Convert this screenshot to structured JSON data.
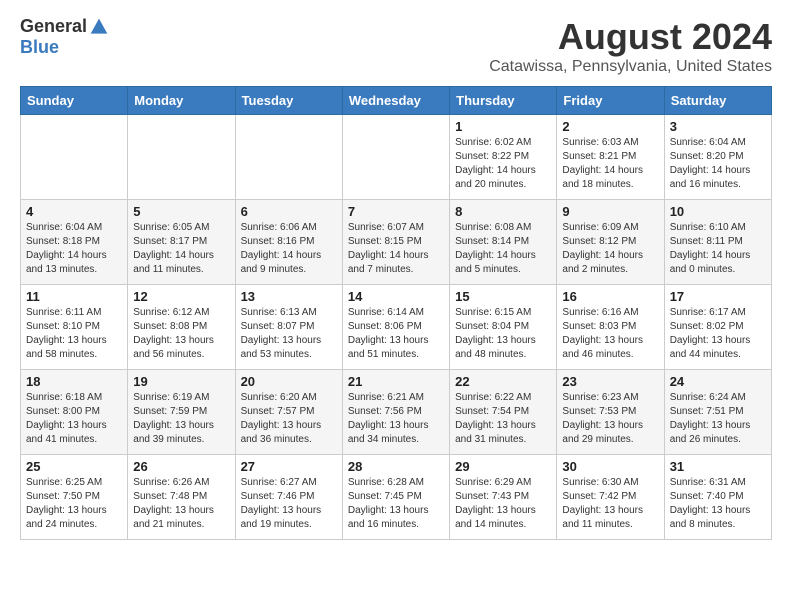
{
  "logo": {
    "general": "General",
    "blue": "Blue"
  },
  "title": {
    "month_year": "August 2024",
    "location": "Catawissa, Pennsylvania, United States"
  },
  "headers": [
    "Sunday",
    "Monday",
    "Tuesday",
    "Wednesday",
    "Thursday",
    "Friday",
    "Saturday"
  ],
  "weeks": [
    [
      {
        "day": "",
        "sunrise": "",
        "sunset": "",
        "daylight": ""
      },
      {
        "day": "",
        "sunrise": "",
        "sunset": "",
        "daylight": ""
      },
      {
        "day": "",
        "sunrise": "",
        "sunset": "",
        "daylight": ""
      },
      {
        "day": "",
        "sunrise": "",
        "sunset": "",
        "daylight": ""
      },
      {
        "day": "1",
        "sunrise": "Sunrise: 6:02 AM",
        "sunset": "Sunset: 8:22 PM",
        "daylight": "Daylight: 14 hours and 20 minutes."
      },
      {
        "day": "2",
        "sunrise": "Sunrise: 6:03 AM",
        "sunset": "Sunset: 8:21 PM",
        "daylight": "Daylight: 14 hours and 18 minutes."
      },
      {
        "day": "3",
        "sunrise": "Sunrise: 6:04 AM",
        "sunset": "Sunset: 8:20 PM",
        "daylight": "Daylight: 14 hours and 16 minutes."
      }
    ],
    [
      {
        "day": "4",
        "sunrise": "Sunrise: 6:04 AM",
        "sunset": "Sunset: 8:18 PM",
        "daylight": "Daylight: 14 hours and 13 minutes."
      },
      {
        "day": "5",
        "sunrise": "Sunrise: 6:05 AM",
        "sunset": "Sunset: 8:17 PM",
        "daylight": "Daylight: 14 hours and 11 minutes."
      },
      {
        "day": "6",
        "sunrise": "Sunrise: 6:06 AM",
        "sunset": "Sunset: 8:16 PM",
        "daylight": "Daylight: 14 hours and 9 minutes."
      },
      {
        "day": "7",
        "sunrise": "Sunrise: 6:07 AM",
        "sunset": "Sunset: 8:15 PM",
        "daylight": "Daylight: 14 hours and 7 minutes."
      },
      {
        "day": "8",
        "sunrise": "Sunrise: 6:08 AM",
        "sunset": "Sunset: 8:14 PM",
        "daylight": "Daylight: 14 hours and 5 minutes."
      },
      {
        "day": "9",
        "sunrise": "Sunrise: 6:09 AM",
        "sunset": "Sunset: 8:12 PM",
        "daylight": "Daylight: 14 hours and 2 minutes."
      },
      {
        "day": "10",
        "sunrise": "Sunrise: 6:10 AM",
        "sunset": "Sunset: 8:11 PM",
        "daylight": "Daylight: 14 hours and 0 minutes."
      }
    ],
    [
      {
        "day": "11",
        "sunrise": "Sunrise: 6:11 AM",
        "sunset": "Sunset: 8:10 PM",
        "daylight": "Daylight: 13 hours and 58 minutes."
      },
      {
        "day": "12",
        "sunrise": "Sunrise: 6:12 AM",
        "sunset": "Sunset: 8:08 PM",
        "daylight": "Daylight: 13 hours and 56 minutes."
      },
      {
        "day": "13",
        "sunrise": "Sunrise: 6:13 AM",
        "sunset": "Sunset: 8:07 PM",
        "daylight": "Daylight: 13 hours and 53 minutes."
      },
      {
        "day": "14",
        "sunrise": "Sunrise: 6:14 AM",
        "sunset": "Sunset: 8:06 PM",
        "daylight": "Daylight: 13 hours and 51 minutes."
      },
      {
        "day": "15",
        "sunrise": "Sunrise: 6:15 AM",
        "sunset": "Sunset: 8:04 PM",
        "daylight": "Daylight: 13 hours and 48 minutes."
      },
      {
        "day": "16",
        "sunrise": "Sunrise: 6:16 AM",
        "sunset": "Sunset: 8:03 PM",
        "daylight": "Daylight: 13 hours and 46 minutes."
      },
      {
        "day": "17",
        "sunrise": "Sunrise: 6:17 AM",
        "sunset": "Sunset: 8:02 PM",
        "daylight": "Daylight: 13 hours and 44 minutes."
      }
    ],
    [
      {
        "day": "18",
        "sunrise": "Sunrise: 6:18 AM",
        "sunset": "Sunset: 8:00 PM",
        "daylight": "Daylight: 13 hours and 41 minutes."
      },
      {
        "day": "19",
        "sunrise": "Sunrise: 6:19 AM",
        "sunset": "Sunset: 7:59 PM",
        "daylight": "Daylight: 13 hours and 39 minutes."
      },
      {
        "day": "20",
        "sunrise": "Sunrise: 6:20 AM",
        "sunset": "Sunset: 7:57 PM",
        "daylight": "Daylight: 13 hours and 36 minutes."
      },
      {
        "day": "21",
        "sunrise": "Sunrise: 6:21 AM",
        "sunset": "Sunset: 7:56 PM",
        "daylight": "Daylight: 13 hours and 34 minutes."
      },
      {
        "day": "22",
        "sunrise": "Sunrise: 6:22 AM",
        "sunset": "Sunset: 7:54 PM",
        "daylight": "Daylight: 13 hours and 31 minutes."
      },
      {
        "day": "23",
        "sunrise": "Sunrise: 6:23 AM",
        "sunset": "Sunset: 7:53 PM",
        "daylight": "Daylight: 13 hours and 29 minutes."
      },
      {
        "day": "24",
        "sunrise": "Sunrise: 6:24 AM",
        "sunset": "Sunset: 7:51 PM",
        "daylight": "Daylight: 13 hours and 26 minutes."
      }
    ],
    [
      {
        "day": "25",
        "sunrise": "Sunrise: 6:25 AM",
        "sunset": "Sunset: 7:50 PM",
        "daylight": "Daylight: 13 hours and 24 minutes."
      },
      {
        "day": "26",
        "sunrise": "Sunrise: 6:26 AM",
        "sunset": "Sunset: 7:48 PM",
        "daylight": "Daylight: 13 hours and 21 minutes."
      },
      {
        "day": "27",
        "sunrise": "Sunrise: 6:27 AM",
        "sunset": "Sunset: 7:46 PM",
        "daylight": "Daylight: 13 hours and 19 minutes."
      },
      {
        "day": "28",
        "sunrise": "Sunrise: 6:28 AM",
        "sunset": "Sunset: 7:45 PM",
        "daylight": "Daylight: 13 hours and 16 minutes."
      },
      {
        "day": "29",
        "sunrise": "Sunrise: 6:29 AM",
        "sunset": "Sunset: 7:43 PM",
        "daylight": "Daylight: 13 hours and 14 minutes."
      },
      {
        "day": "30",
        "sunrise": "Sunrise: 6:30 AM",
        "sunset": "Sunset: 7:42 PM",
        "daylight": "Daylight: 13 hours and 11 minutes."
      },
      {
        "day": "31",
        "sunrise": "Sunrise: 6:31 AM",
        "sunset": "Sunset: 7:40 PM",
        "daylight": "Daylight: 13 hours and 8 minutes."
      }
    ]
  ]
}
